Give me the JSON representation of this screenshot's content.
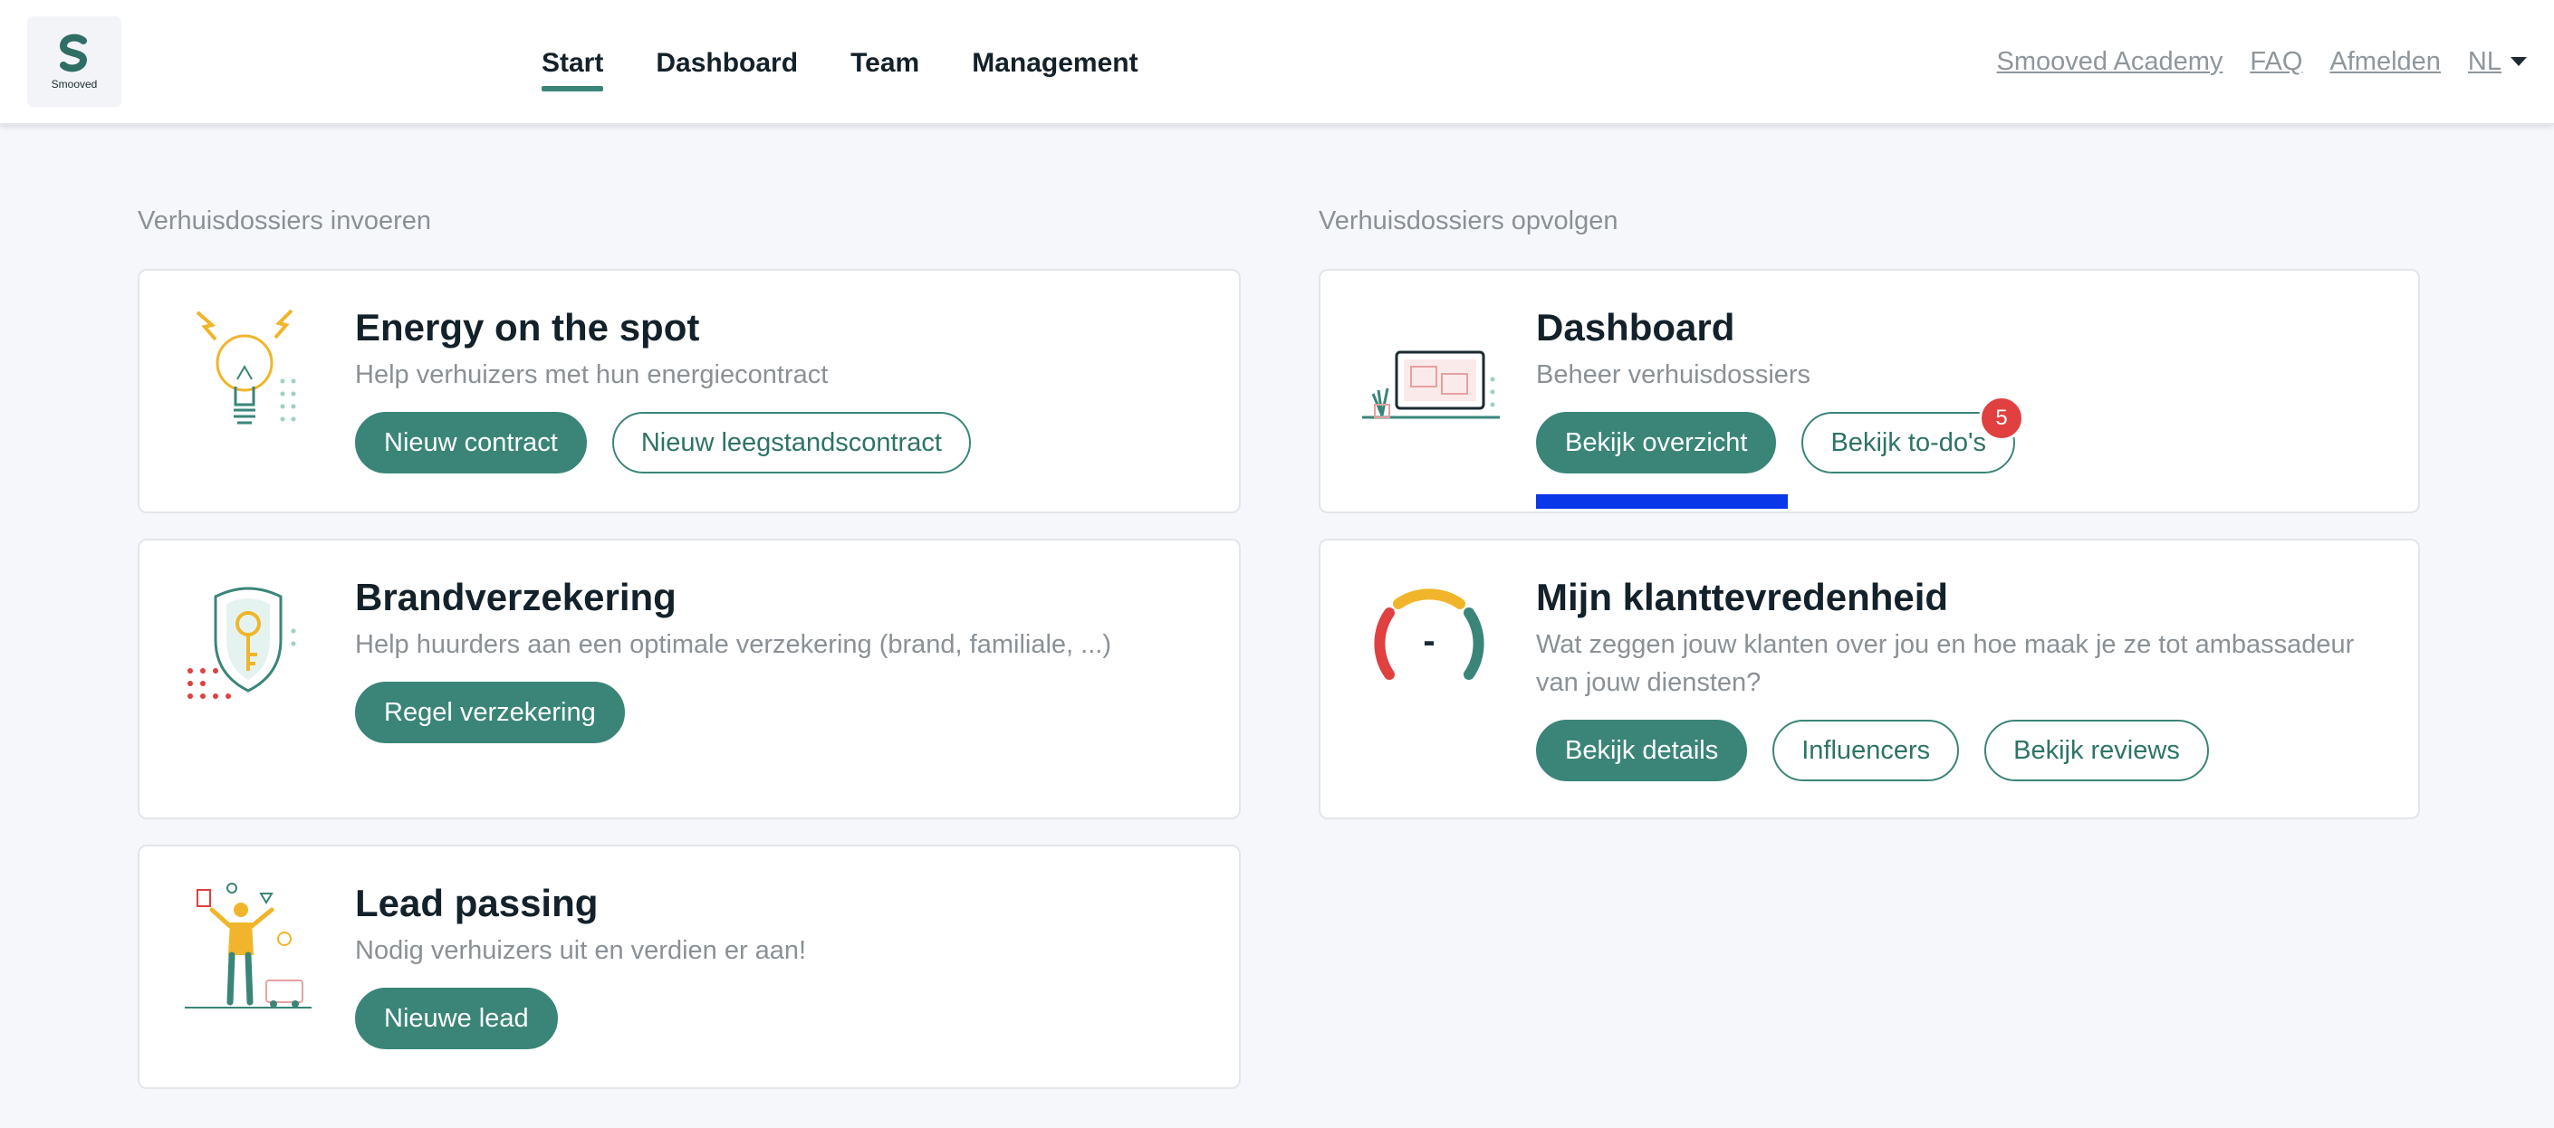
{
  "header": {
    "logo_text": "Smooved",
    "nav": [
      {
        "label": "Start",
        "active": true
      },
      {
        "label": "Dashboard",
        "active": false
      },
      {
        "label": "Team",
        "active": false
      },
      {
        "label": "Management",
        "active": false
      }
    ],
    "util_links": [
      "Smooved Academy",
      "FAQ",
      "Afmelden"
    ],
    "language": "NL"
  },
  "left_section": {
    "title": "Verhuisdossiers invoeren",
    "cards": [
      {
        "title": "Energy on the spot",
        "description": "Help verhuizers met hun energiecontract",
        "buttons": [
          "Nieuw contract",
          "Nieuw leegstandscontract"
        ]
      },
      {
        "title": "Brandverzekering",
        "description": "Help huurders aan een optimale verzekering (brand, familiale, ...)",
        "buttons": [
          "Regel verzekering"
        ]
      },
      {
        "title": "Lead passing",
        "description": "Nodig verhuizers uit en verdien er aan!",
        "buttons": [
          "Nieuwe lead"
        ]
      }
    ]
  },
  "right_section": {
    "title": "Verhuisdossiers opvolgen",
    "cards": [
      {
        "title": "Dashboard",
        "description": "Beheer verhuisdossiers",
        "buttons": [
          "Bekijk overzicht",
          "Bekijk to-do's"
        ],
        "todo_badge": "5"
      },
      {
        "title": "Mijn klanttevredenheid",
        "description": "Wat zeggen jouw klanten over jou en hoe maak je ze tot ambassadeur van jouw diensten?",
        "gauge_value": "-",
        "buttons": [
          "Bekijk details",
          "Influencers",
          "Bekijk reviews"
        ]
      }
    ]
  },
  "colors": {
    "accent": "#3a8578",
    "badge": "#e04040",
    "focus_bar": "#0a37e8",
    "background": "#f6f7fb"
  }
}
